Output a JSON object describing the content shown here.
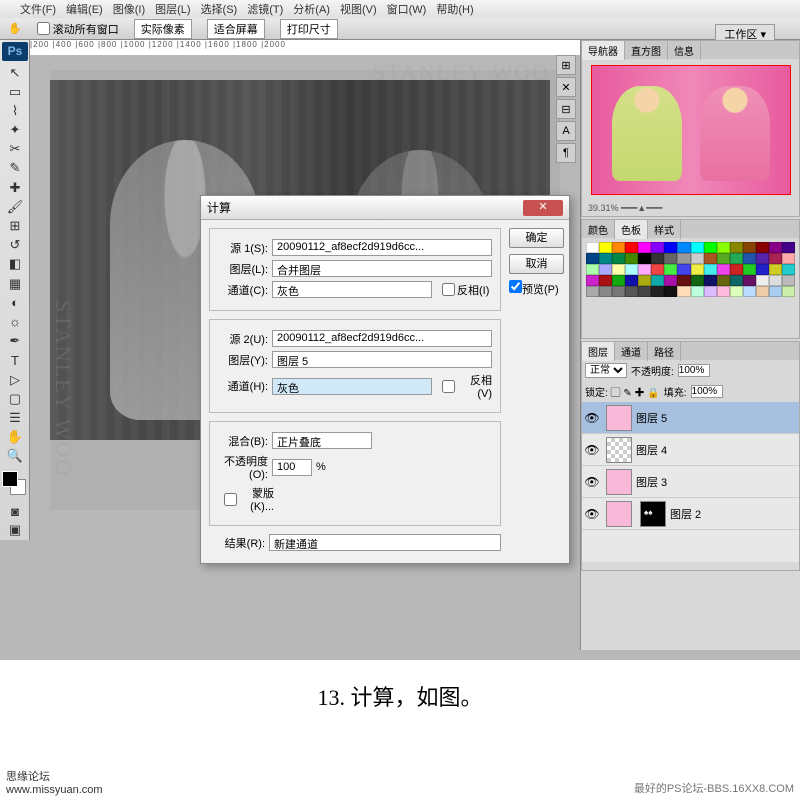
{
  "menu": [
    "文件(F)",
    "编辑(E)",
    "图像(I)",
    "图层(L)",
    "选择(S)",
    "滤镜(T)",
    "分析(A)",
    "视图(V)",
    "窗口(W)",
    "帮助(H)"
  ],
  "optbar": {
    "scroll": "滚动所有窗口",
    "actual": "实际像素",
    "fit": "适合屏幕",
    "print": "打印尺寸"
  },
  "workspace_label": "工作区 ▾",
  "dialog": {
    "title": "计算",
    "src1_label": "源 1(S):",
    "src1_value": "20090112_af8ecf2d919d6cc...",
    "layer1_label": "图层(L):",
    "layer1_value": "合并图层",
    "channel1_label": "通道(C):",
    "channel1_value": "灰色",
    "invert1": "反相(I)",
    "src2_label": "源 2(U):",
    "src2_value": "20090112_af8ecf2d919d6cc...",
    "layer2_label": "图层(Y):",
    "layer2_value": "图层 5",
    "channel2_label": "通道(H):",
    "channel2_value": "灰色",
    "invert2": "反相(V)",
    "blend_label": "混合(B):",
    "blend_value": "正片叠底",
    "opacity_label": "不透明度(O):",
    "opacity_value": "100",
    "opacity_pct": "%",
    "mask": "蒙版(K)...",
    "result_label": "结果(R):",
    "result_value": "新建通道",
    "ok": "确定",
    "cancel": "取消",
    "preview": "预览(P)"
  },
  "nav_tabs": [
    "导航器",
    "直方图",
    "信息"
  ],
  "nav_zoom": "39.31%",
  "color_tabs": [
    "颜色",
    "色板",
    "样式"
  ],
  "layer_tabs": [
    "图层",
    "通道",
    "路径"
  ],
  "blend_mode": "正常",
  "opacity_lbl": "不透明度:",
  "opacity_val": "100%",
  "fill_lbl": "填充:",
  "fill_val": "100%",
  "layers": [
    {
      "name": "图层 5",
      "sel": true,
      "thumb": "pink"
    },
    {
      "name": "图层 4",
      "sel": false,
      "thumb": "checker"
    },
    {
      "name": "图层 3",
      "sel": false,
      "thumb": "pink"
    },
    {
      "name": "图层 2",
      "sel": false,
      "thumb": "mask"
    }
  ],
  "caption": "13. 计算，如图。",
  "footer_left_1": "思缘论坛",
  "footer_left_2": "www.missyuan.com",
  "footer_right": "最好的PS论坛-BBS.16XX8.COM",
  "watermark": "STANLEY WOO",
  "swatch_colors": [
    "#fff",
    "#ff0",
    "#f80",
    "#f00",
    "#f0f",
    "#80f",
    "#00f",
    "#08f",
    "#0ff",
    "#0f0",
    "#8f0",
    "#880",
    "#840",
    "#800",
    "#808",
    "#408",
    "#048",
    "#088",
    "#084",
    "#480",
    "#000",
    "#333",
    "#666",
    "#999",
    "#ccc",
    "#a52",
    "#5a2",
    "#2a5",
    "#25a",
    "#52a",
    "#a25",
    "#faa",
    "#afa",
    "#aaf",
    "#ffa",
    "#aff",
    "#faf",
    "#e44",
    "#4e4",
    "#44e",
    "#ee4",
    "#4ee",
    "#e4e",
    "#c22",
    "#2c2",
    "#22c",
    "#cc2",
    "#2cc",
    "#c2c",
    "#a11",
    "#1a1",
    "#11a",
    "#aa1",
    "#1aa",
    "#a1a",
    "#611",
    "#161",
    "#116",
    "#661",
    "#166",
    "#616",
    "#eee",
    "#ddd",
    "#bbb",
    "#aaa",
    "#888",
    "#777",
    "#555",
    "#444",
    "#222",
    "#111",
    "#fdb",
    "#bfd",
    "#dbf",
    "#fbd",
    "#dfb",
    "#bdf",
    "#eca",
    "#ace",
    "#cea",
    "#eac"
  ]
}
